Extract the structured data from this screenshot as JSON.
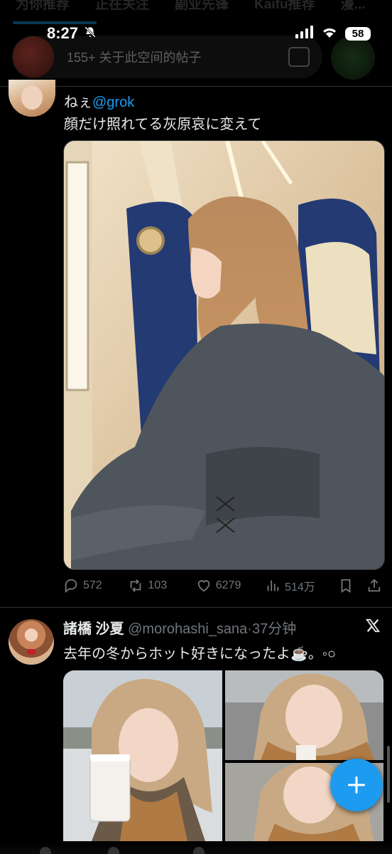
{
  "top_tabs": [
    "为你推荐",
    "正在关注",
    "副业先锋",
    "Kaifu推荐",
    "漫..."
  ],
  "status": {
    "time": "8:27",
    "battery": "58"
  },
  "spaces_banner": {
    "text": "155+ 关于此空间的帖子"
  },
  "tweet1": {
    "line1_prefix": "ねぇ",
    "mention": "@grok",
    "line2": "顔だけ照れてる灰原哀に変えて",
    "replies": "572",
    "retweets": "103",
    "likes": "6279",
    "views": "514万"
  },
  "tweet2": {
    "name": "諸橋 沙夏",
    "handle_time": "@morohashi_sana·37分钟",
    "text": "去年の冬からホット好きになったよ☕️。◦○"
  },
  "colors": {
    "accent": "#1d9bf0",
    "muted": "#71767b",
    "text": "#e7e9ea",
    "background": "#000000"
  }
}
